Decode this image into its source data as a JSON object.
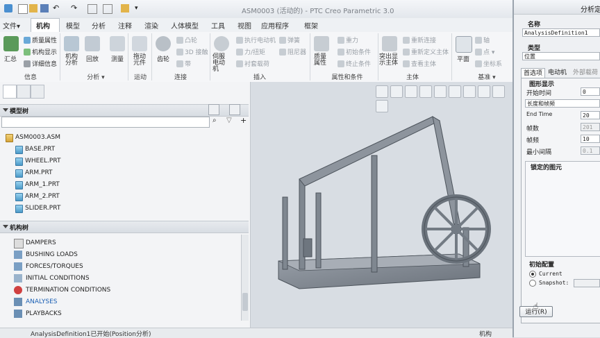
{
  "window": {
    "title": "ASM0003 (活动的) - PTC Creo Parametric 3.0"
  },
  "menu_tabs": [
    {
      "label": "文件▾"
    },
    {
      "label": "机构"
    },
    {
      "label": "模型"
    },
    {
      "label": "分析"
    },
    {
      "label": "注释"
    },
    {
      "label": "渲染"
    },
    {
      "label": "人体模型"
    },
    {
      "label": "工具"
    },
    {
      "label": "视图"
    },
    {
      "label": "应用程序"
    },
    {
      "label": "框架"
    }
  ],
  "ribbon": {
    "info": {
      "caption": "信息",
      "summary": "汇总",
      "mass_props": "质量属性",
      "mech_display": "机构显示",
      "details": "详细信息"
    },
    "analysis": {
      "caption": "分析 ▾",
      "mech_analysis": "机构分析",
      "playback": "回放",
      "measure": "测量"
    },
    "motion": {
      "caption": "运动",
      "drag": "拖动元件"
    },
    "connection": {
      "caption": "连接",
      "gear": "齿轮",
      "cam": "凸轮",
      "3d_contact": "3D 接触",
      "belt": "带"
    },
    "insert": {
      "caption": "插入",
      "servo": "伺服电动机",
      "exec_motor": "执行电动机",
      "force_torque": "力/扭矩",
      "bushing": "衬套载荷",
      "spring": "弹簧",
      "damper": "阻尼器"
    },
    "props": {
      "caption": "属性和条件",
      "mass": "质量属性",
      "gravity": "重力",
      "init_cond": "初始条件",
      "term_cond": "终止条件"
    },
    "body": {
      "caption": "主体",
      "body_highlight": "突出显示主体",
      "reconnect": "重新连接",
      "redefine": "重新定义主体",
      "view_body": "查看主体"
    },
    "datum": {
      "caption": "基准 ▾",
      "plane": "平面",
      "axis": "轴",
      "point": "点 ▾",
      "csys": "坐标系"
    }
  },
  "model_tree": {
    "header": "模型树",
    "items": [
      {
        "label": "ASM0003.ASM"
      },
      {
        "label": "BASE.PRT"
      },
      {
        "label": "WHEEL.PRT"
      },
      {
        "label": "ARM.PRT"
      },
      {
        "label": "ARM_1.PRT"
      },
      {
        "label": "ARM_2.PRT"
      },
      {
        "label": "SLIDER.PRT"
      }
    ]
  },
  "mech_tree": {
    "header": "机构树",
    "items": [
      {
        "label": "DAMPERS"
      },
      {
        "label": "BUSHING LOADS"
      },
      {
        "label": "FORCES/TORQUES"
      },
      {
        "label": "INITIAL CONDITIONS"
      },
      {
        "label": "TERMINATION CONDITIONS"
      },
      {
        "label": "ANALYSES",
        "selected": true,
        "color": "#1a5fb4"
      },
      {
        "label": "PLAYBACKS"
      }
    ]
  },
  "status": {
    "message": "AnalysisDefinition1已开始(Position分析)",
    "right": "机构"
  },
  "dialog": {
    "title": "分析定",
    "name_label": "名称",
    "name_value": "AnalysisDefinition1",
    "type_label": "类型",
    "type_value": "位置",
    "tabs": [
      {
        "label": "首选项",
        "active": true
      },
      {
        "label": "电动机"
      },
      {
        "label": "外部载荷"
      }
    ],
    "graph_label": "图形显示",
    "start_time_label": "开始时间",
    "start_time_value": "0",
    "mode_value": "长度和帧频",
    "end_time_label": "End Time",
    "end_time_value": "20",
    "frames_label": "帧数",
    "frames_value": "201",
    "rate_label": "帧频",
    "rate_value": "10",
    "min_interval_label": "最小间隔",
    "min_interval_value": "0.1",
    "locked_label": "锁定的图元",
    "init_config_label": "初始配置",
    "radio_current": "Current",
    "radio_snapshot": "Snapshot:",
    "run_button": "运行(R)"
  }
}
